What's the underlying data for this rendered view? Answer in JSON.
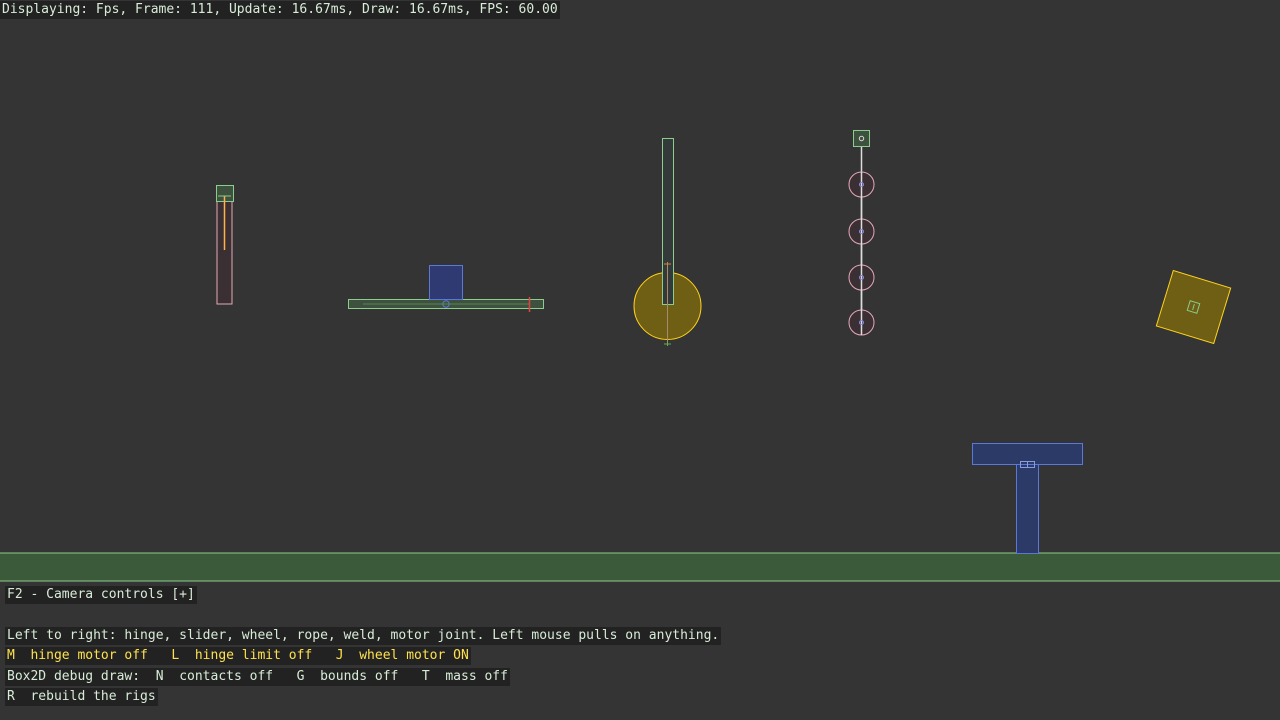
{
  "status_bar": "Displaying: Fps, Frame: 111, Update: 16.67ms, Draw: 16.67ms, FPS: 60.00",
  "camera_toggle": "F2 - Camera controls [+]",
  "help": {
    "description": "Left to right: hinge, slider, wheel, rope, weld, motor joint. Left mouse pulls on anything.",
    "motor_keys": [
      {
        "key": "M",
        "text": "hinge motor off"
      },
      {
        "key": "L",
        "text": "hinge limit off"
      },
      {
        "key": "J",
        "text": "wheel motor ON"
      }
    ],
    "debug_prefix": "Box2D debug draw:",
    "debug_keys": [
      {
        "key": "N",
        "text": "contacts off"
      },
      {
        "key": "G",
        "text": "bounds off"
      },
      {
        "key": "T",
        "text": "mass off"
      }
    ],
    "rebuild": {
      "key": "R",
      "text": "rebuild the rigs"
    }
  },
  "colors": {
    "background": "#343434",
    "ground_fill": "#3a5a3a",
    "static_body": "#8ccc8c",
    "dynamic_body": "#e6a8b8",
    "kinematic_body": "#5a78d8",
    "sleeping_body": "#ffd21e",
    "joint_line": "#dcdcdc",
    "accent_text": "#ffe14d"
  }
}
